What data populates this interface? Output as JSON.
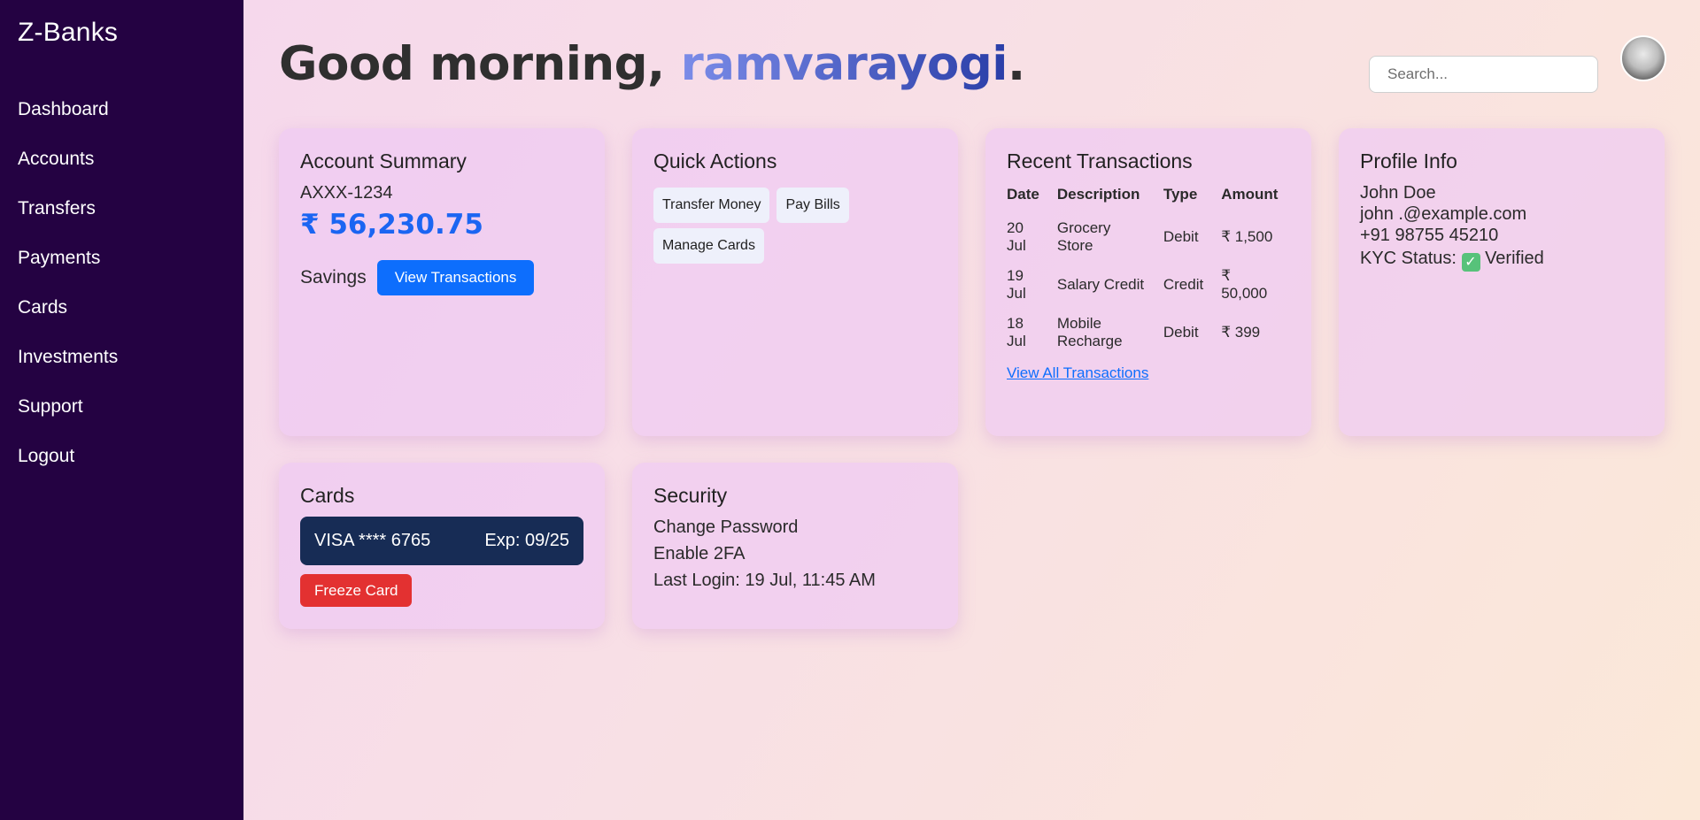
{
  "sidebar": {
    "brand": "Z-Banks",
    "items": [
      {
        "label": "Dashboard"
      },
      {
        "label": "Accounts"
      },
      {
        "label": "Transfers"
      },
      {
        "label": "Payments"
      },
      {
        "label": "Cards"
      },
      {
        "label": "Investments"
      },
      {
        "label": "Support"
      },
      {
        "label": "Logout"
      }
    ]
  },
  "header": {
    "greeting_prefix": "Good morning, ",
    "username": "ramvarayogi",
    "greeting_suffix": ".",
    "search_placeholder": "Search..."
  },
  "account_summary": {
    "title": "Account Summary",
    "account_number": "AXXX-1234",
    "balance": "₹ 56,230.75",
    "account_type": "Savings",
    "view_button": "View Transactions"
  },
  "quick_actions": {
    "title": "Quick Actions",
    "actions": [
      "Transfer Money",
      "Pay Bills",
      "Manage Cards"
    ]
  },
  "transactions": {
    "title": "Recent Transactions",
    "headers": [
      "Date",
      "Description",
      "Type",
      "Amount"
    ],
    "rows": [
      {
        "date": "20 Jul",
        "description": "Grocery Store",
        "type": "Debit",
        "amount": "₹ 1,500"
      },
      {
        "date": "19 Jul",
        "description": "Salary Credit",
        "type": "Credit",
        "amount": "₹ 50,000"
      },
      {
        "date": "18 Jul",
        "description": "Mobile Recharge",
        "type": "Debit",
        "amount": "₹ 399"
      }
    ],
    "view_all": "View All Transactions"
  },
  "profile": {
    "title": "Profile Info",
    "name": "John Doe",
    "email": "john .@example.com",
    "phone": "+91 98755 45210",
    "kyc_label": "KYC Status:",
    "kyc_icon": "✓",
    "kyc_value": "Verified"
  },
  "cards": {
    "title": "Cards",
    "card_number": "VISA **** 6765",
    "expiry": "Exp: 09/25",
    "freeze_button": "Freeze Card"
  },
  "security": {
    "title": "Security",
    "change_password": "Change Password",
    "enable_2fa": "Enable 2FA",
    "last_login": "Last Login: 19 Jul, 11:45 AM"
  },
  "colors": {
    "sidebar_bg": "#240242",
    "accent_blue": "#0d6efd",
    "danger_red": "#e33131",
    "card_bg": "#172c55",
    "verified_green": "#57c27a"
  }
}
